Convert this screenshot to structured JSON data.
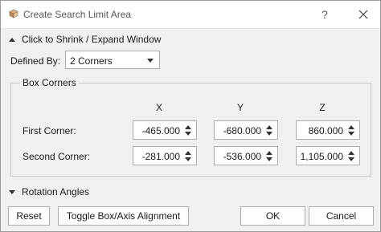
{
  "window": {
    "title": "Create Search Limit Area",
    "help_label": "?",
    "title_icon": "cube-icon",
    "help_icon": "help-icon",
    "close_icon": "close-icon"
  },
  "collapse_toggle": {
    "label": "Click to Shrink / Expand Window"
  },
  "defined_by": {
    "label": "Defined By:",
    "value": "2 Corners"
  },
  "box_corners": {
    "title": "Box Corners",
    "columns": [
      "X",
      "Y",
      "Z"
    ],
    "rows": [
      {
        "label": "First Corner:",
        "values": [
          "-465.000",
          "-680.000",
          "860.000"
        ]
      },
      {
        "label": "Second Corner:",
        "values": [
          "-281.000",
          "-536.000",
          "1,105.000"
        ]
      }
    ]
  },
  "rotation_angles": {
    "label": "Rotation Angles"
  },
  "buttons": {
    "reset": "Reset",
    "toggle": "Toggle Box/Axis Alignment",
    "ok": "OK",
    "cancel": "Cancel"
  }
}
